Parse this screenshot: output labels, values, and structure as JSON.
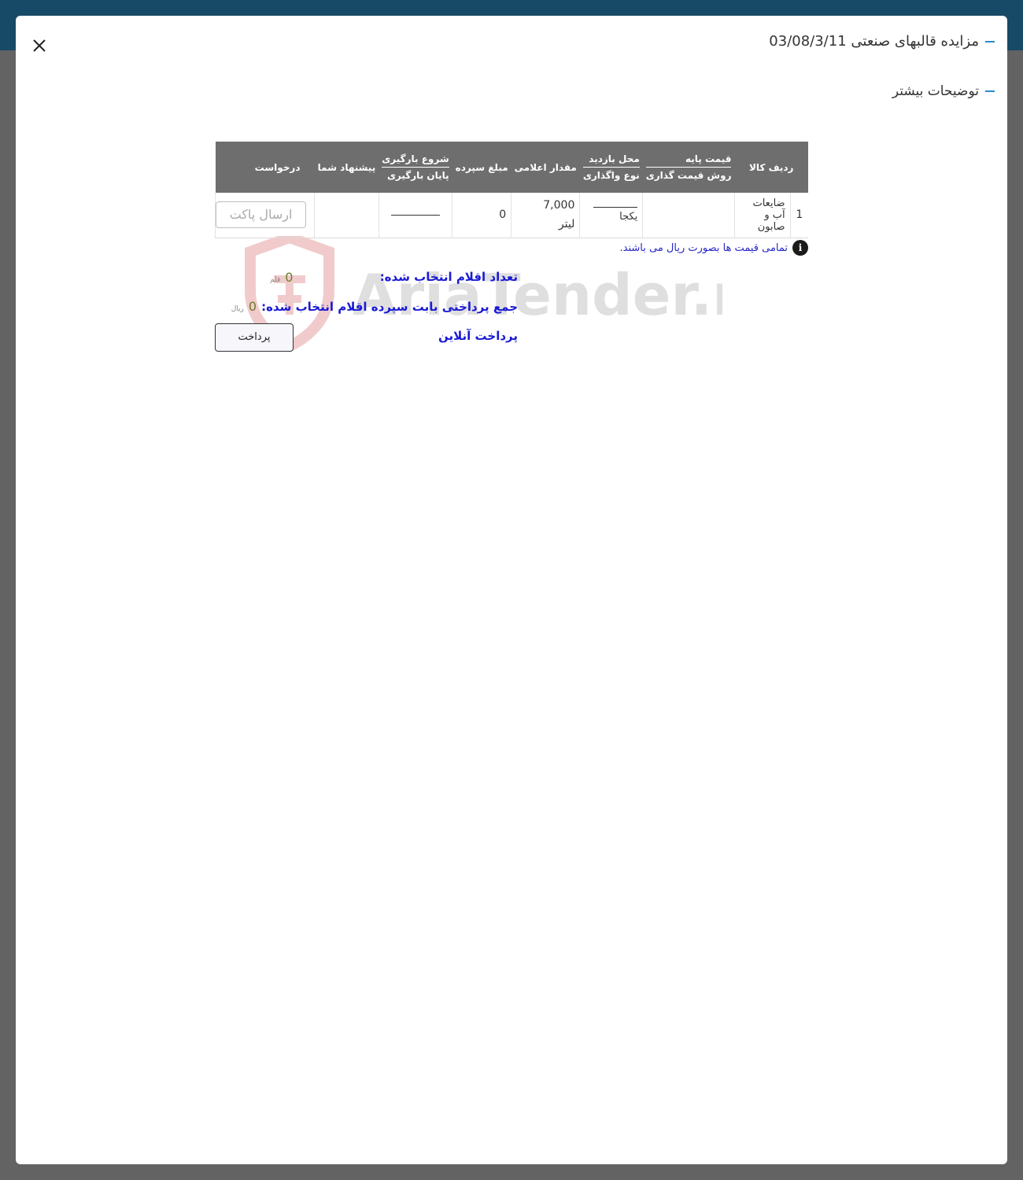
{
  "header": {
    "title": "مزایده قالبهای صنعتی 03/08/3/11",
    "more_details": "توضیحات بیشتر"
  },
  "table": {
    "headers": {
      "row_item": "ردیف کالا",
      "base_price": "قیمت پایه",
      "pricing_method": "روش قیمت گذاری",
      "visit_location": "محل بازدید",
      "assignment_type": "نوع واگذاری",
      "announced_qty": "مقدار اعلامی",
      "deposit": "مبلغ سپرده",
      "loading_start": "شروع بارگیری",
      "loading_end": "پایان بارگیری",
      "your_offer": "پیشنهاد شما",
      "request": "درخواست"
    },
    "rows": [
      {
        "index": "1",
        "item": "ضایعات آب و صابون",
        "base_price": "",
        "assignment_type": "یکجا",
        "quantity": "7,000",
        "unit": "لیتر",
        "deposit": "0",
        "offer": "",
        "send_label": "ارسال پاکت"
      }
    ]
  },
  "note": "تمامی قیمت ها بصورت ریال می باشند.",
  "summary": {
    "selected_count_label": "تعداد اقلام انتخاب شده:",
    "selected_count_value": "0",
    "selected_count_unit": "قلم",
    "total_label": "جمع پرداختی بابت سپرده اقلام انتخاب شده:",
    "total_value": "0",
    "total_unit": "ریال"
  },
  "pay_online": "پرداخت آنلاین",
  "pay_button": "پرداخت",
  "watermark": "AriaTender.neT",
  "colors": {
    "topbar": "#164a66",
    "table_header": "#6e6e6e",
    "accent_blue": "#1a1ad4",
    "dash": "#2b88c8"
  }
}
